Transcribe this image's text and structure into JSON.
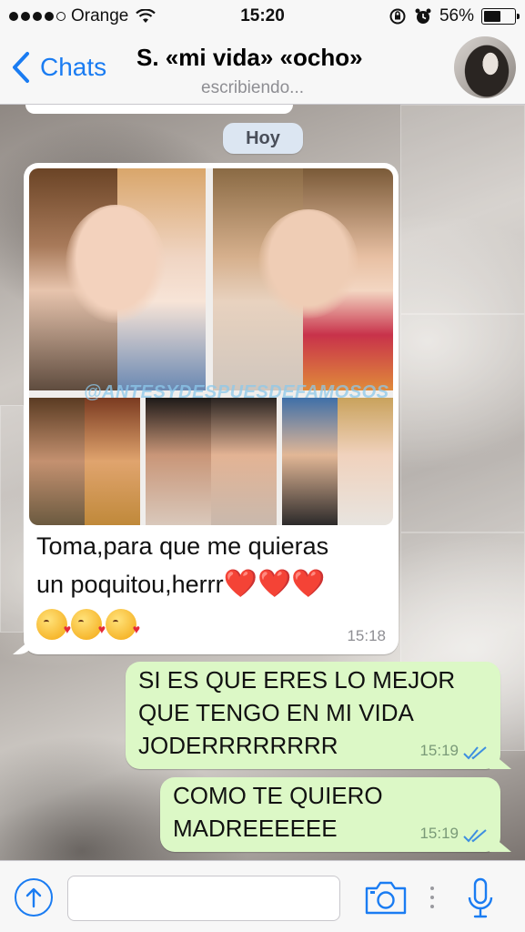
{
  "status_bar": {
    "carrier": "Orange",
    "time": "15:20",
    "battery": "56%",
    "battery_level": 0.56,
    "icons": [
      "signal-dots-icon",
      "wifi-icon",
      "rotation-lock-icon",
      "alarm-icon",
      "battery-icon"
    ]
  },
  "nav": {
    "back_label": "Chats",
    "contact_name": "S. «mi vida» «ocho»",
    "contact_status": "escribiendo..."
  },
  "chat": {
    "date_label": "Hoy",
    "messages": [
      {
        "direction": "incoming",
        "type": "image",
        "image_watermark": "@ANTESYDESPUESDEFAMOSOS",
        "text_line1": "Toma,para que me quieras",
        "text_line2": "un poquitou,herrr",
        "hearts": "❤️❤️❤️",
        "emojis": "😘😘😘",
        "time": "15:18"
      },
      {
        "direction": "outgoing",
        "type": "text",
        "text": "SI ES QUE ERES LO MEJOR QUE TENGO EN MI VIDA JODERRRRRRRR",
        "line1": "SI ES QUE ERES LO MEJOR",
        "line2": "QUE TENGO EN MI VIDA",
        "line3": "JODERRRRRRRR",
        "time": "15:19",
        "status_icon": "double-check-icon"
      },
      {
        "direction": "outgoing",
        "type": "text",
        "text": "COMO TE QUIERO MADREEEEEE",
        "line1": "COMO TE QUIERO",
        "line2": "MADREEEEEE",
        "time": "15:19",
        "status_icon": "double-check-icon"
      }
    ]
  },
  "input_bar": {
    "placeholder": "",
    "icons": [
      "share-arrow-icon",
      "camera-icon",
      "microphone-icon"
    ]
  },
  "colors": {
    "accent": "#1a7cf2",
    "outgoing_bubble": "#dcf8c6",
    "incoming_bubble": "#ffffff",
    "date_pill": "#dce6f2",
    "read_check": "#3d8ee0"
  }
}
